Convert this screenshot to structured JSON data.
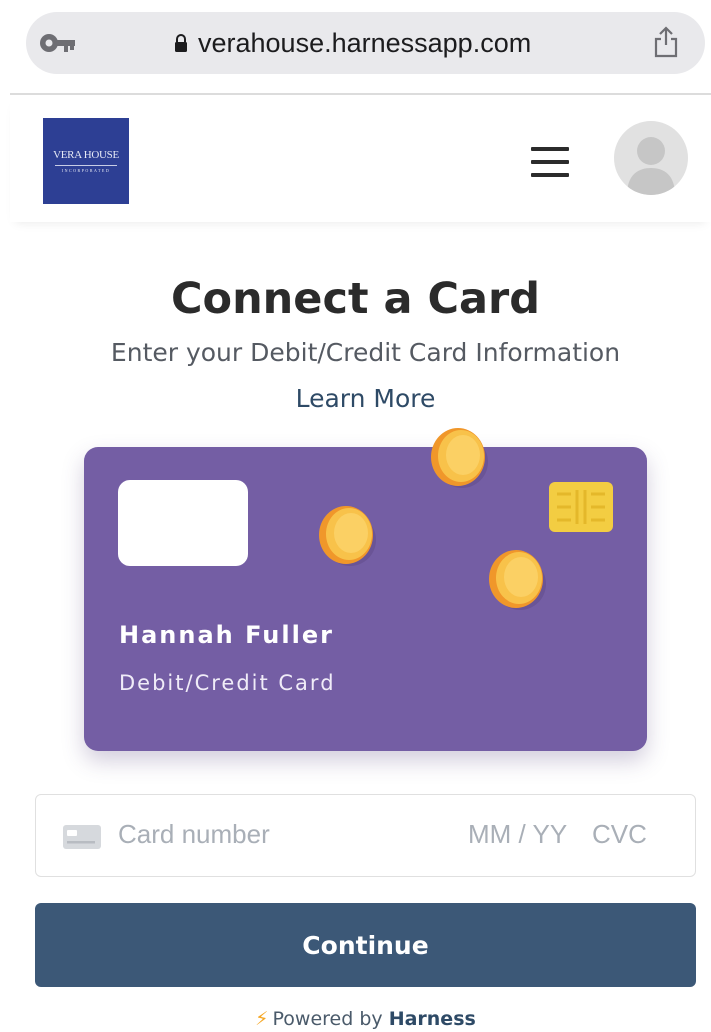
{
  "browser": {
    "url": "verahouse.harnessapp.com",
    "left_icon": "key-icon",
    "lock_icon": "lock-icon",
    "right_icon": "share-icon"
  },
  "header": {
    "logo": {
      "text": "VERA HOUSE",
      "subtext": "INCORPORATED",
      "background": "#2d3f94"
    },
    "menu_icon": "hamburger-icon",
    "avatar_icon": "user-avatar-icon"
  },
  "main": {
    "title": "Connect a Card",
    "subtitle": "Enter your Debit/Credit Card Information",
    "learn_more": "Learn More"
  },
  "card_preview": {
    "holder_name": "Hannah Fuller",
    "card_type": "Debit/Credit Card",
    "background": "#745ea4",
    "chip_color": "#f3cd42",
    "coin_color": "#f5a623"
  },
  "card_input": {
    "brand_icon": "credit-card-icon",
    "number_placeholder": "Card number",
    "expiry_placeholder": "MM / YY",
    "cvc_placeholder": "CVC"
  },
  "actions": {
    "continue_label": "Continue",
    "button_color": "#3c5877"
  },
  "footer": {
    "powered_by": "Powered by",
    "brand": "Harness",
    "bolt_icon": "lightning-bolt-icon"
  }
}
